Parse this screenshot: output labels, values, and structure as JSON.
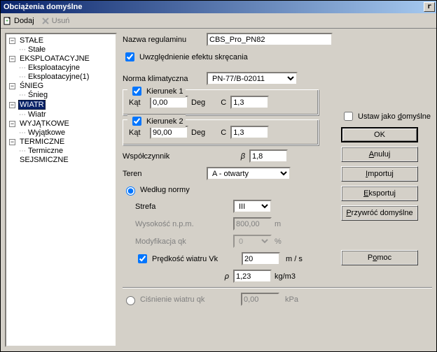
{
  "window": {
    "title": "Obciążenia domyślne",
    "close_glyph": "r"
  },
  "toolbar": {
    "add": {
      "label": "Dodaj",
      "icon": "add-page-icon"
    },
    "remove": {
      "label": "Usuń",
      "icon": "delete-x-icon"
    }
  },
  "tree": {
    "nodes": [
      {
        "label": "STAŁE",
        "children": [
          {
            "label": "Stałe"
          }
        ]
      },
      {
        "label": "EKSPLOATACYJNE",
        "children": [
          {
            "label": "Eksploatacyjne"
          },
          {
            "label": "Eksploatacyjne(1)"
          }
        ]
      },
      {
        "label": "ŚNIEG",
        "children": [
          {
            "label": "Śnieg"
          }
        ]
      },
      {
        "label": "WIATR",
        "selected": true,
        "children": [
          {
            "label": "Wiatr"
          }
        ]
      },
      {
        "label": "WYJĄTKOWE",
        "children": [
          {
            "label": "Wyjątkowe"
          }
        ]
      },
      {
        "label": "TERMICZNE",
        "children": [
          {
            "label": "Termiczne"
          }
        ]
      },
      {
        "label": "SEJSMICZNE"
      }
    ]
  },
  "form": {
    "regulation_label": "Nazwa regulaminu",
    "regulation_value": "CBS_Pro_PN82",
    "twist_label": "Uwzględnienie efektu skręcania",
    "twist_checked": true,
    "climate_label": "Norma klimatyczna",
    "climate_value": "PN-77/B-02011",
    "dir1": {
      "title": "Kierunek 1",
      "checked": true,
      "angle_label": "Kąt",
      "angle_value": "0,00",
      "angle_unit": "Deg",
      "c_label": "C",
      "c_value": "1,3"
    },
    "dir2": {
      "title": "Kierunek 2",
      "checked": true,
      "angle_label": "Kąt",
      "angle_value": "90,00",
      "angle_unit": "Deg",
      "c_label": "C",
      "c_value": "1,3"
    },
    "coef_label": "Współczynnik",
    "coef_sym": "β",
    "coef_value": "1,8",
    "terrain_label": "Teren",
    "terrain_value": "A - otwarty",
    "by_standard_label": "Według normy",
    "zone_label": "Strefa",
    "zone_value": "III",
    "height_label": "Wysokość n.p.m.",
    "height_value": "800,00",
    "height_unit": "m",
    "mod_label": "Modyfikacja qk",
    "mod_value": "0",
    "mod_unit": "%",
    "speed_label": "Prędkość wiatru Vk",
    "speed_checked": true,
    "speed_value": "20",
    "speed_unit": "m / s",
    "rho_sym": "ρ",
    "rho_value": "1,23",
    "rho_unit": "kg/m3",
    "pressure_label": "Ciśnienie wiatru qk",
    "pressure_value": "0,00",
    "pressure_unit": "kPa"
  },
  "buttons": {
    "set_default": "Ustaw jako domyślne",
    "ok": "OK",
    "cancel": "Anuluj",
    "import": "Importuj",
    "export": "Eksportuj",
    "restore": "Przywróć domyślne",
    "help": "Pomoc"
  },
  "mnemonics": {
    "set_default": "d",
    "cancel": "A",
    "import": "I",
    "export": "E",
    "restore": "P",
    "help": "o"
  }
}
